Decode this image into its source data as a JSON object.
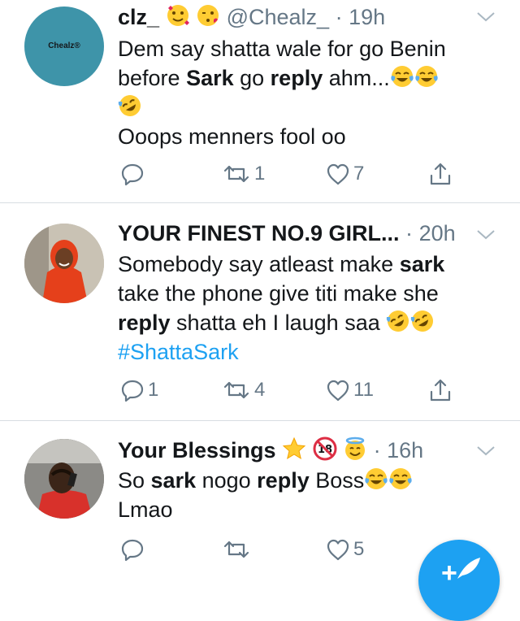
{
  "tweets": [
    {
      "avatar_text": "Chealz®",
      "display_name": "clz_",
      "handle": "@Chealz_",
      "time": "19h",
      "separator": "·",
      "lines": {
        "l1": "Dem say shatta wale for go Benin",
        "l2_a": "before ",
        "l2_b": "Sark",
        "l2_c": " go ",
        "l2_d": "reply",
        "l2_e": " ahm...",
        "l4": "Ooops menners fool oo"
      },
      "reply_count": "",
      "retweet_count": "1",
      "like_count": "7"
    },
    {
      "display_name": "YOUR FINEST NO.9 GIRL...",
      "time": "20h",
      "separator": "·",
      "lines": {
        "l1_a": "Somebody say atleast make ",
        "l1_b": "sark",
        "l2": "take the phone give titi make she",
        "l3_a": "reply",
        "l3_b": " shatta eh I laugh saa",
        "l4": "#ShattaSark"
      },
      "reply_count": "1",
      "retweet_count": "4",
      "like_count": "11"
    },
    {
      "display_name": "Your Blessings",
      "time": "16h",
      "separator": "·",
      "lines": {
        "l1_a": "So ",
        "l1_b": "sark",
        "l1_c": " nogo ",
        "l1_d": "reply",
        "l1_e": " Boss",
        "l2": "Lmao"
      },
      "reply_count": "",
      "retweet_count": "",
      "like_count": "5"
    }
  ],
  "colors": {
    "accent": "#1da1f2",
    "muted": "#657786",
    "divider": "#d8dde2"
  },
  "icons": [
    "reply-icon",
    "retweet-icon",
    "like-icon",
    "share-icon",
    "chevron-down-icon",
    "compose-icon"
  ]
}
